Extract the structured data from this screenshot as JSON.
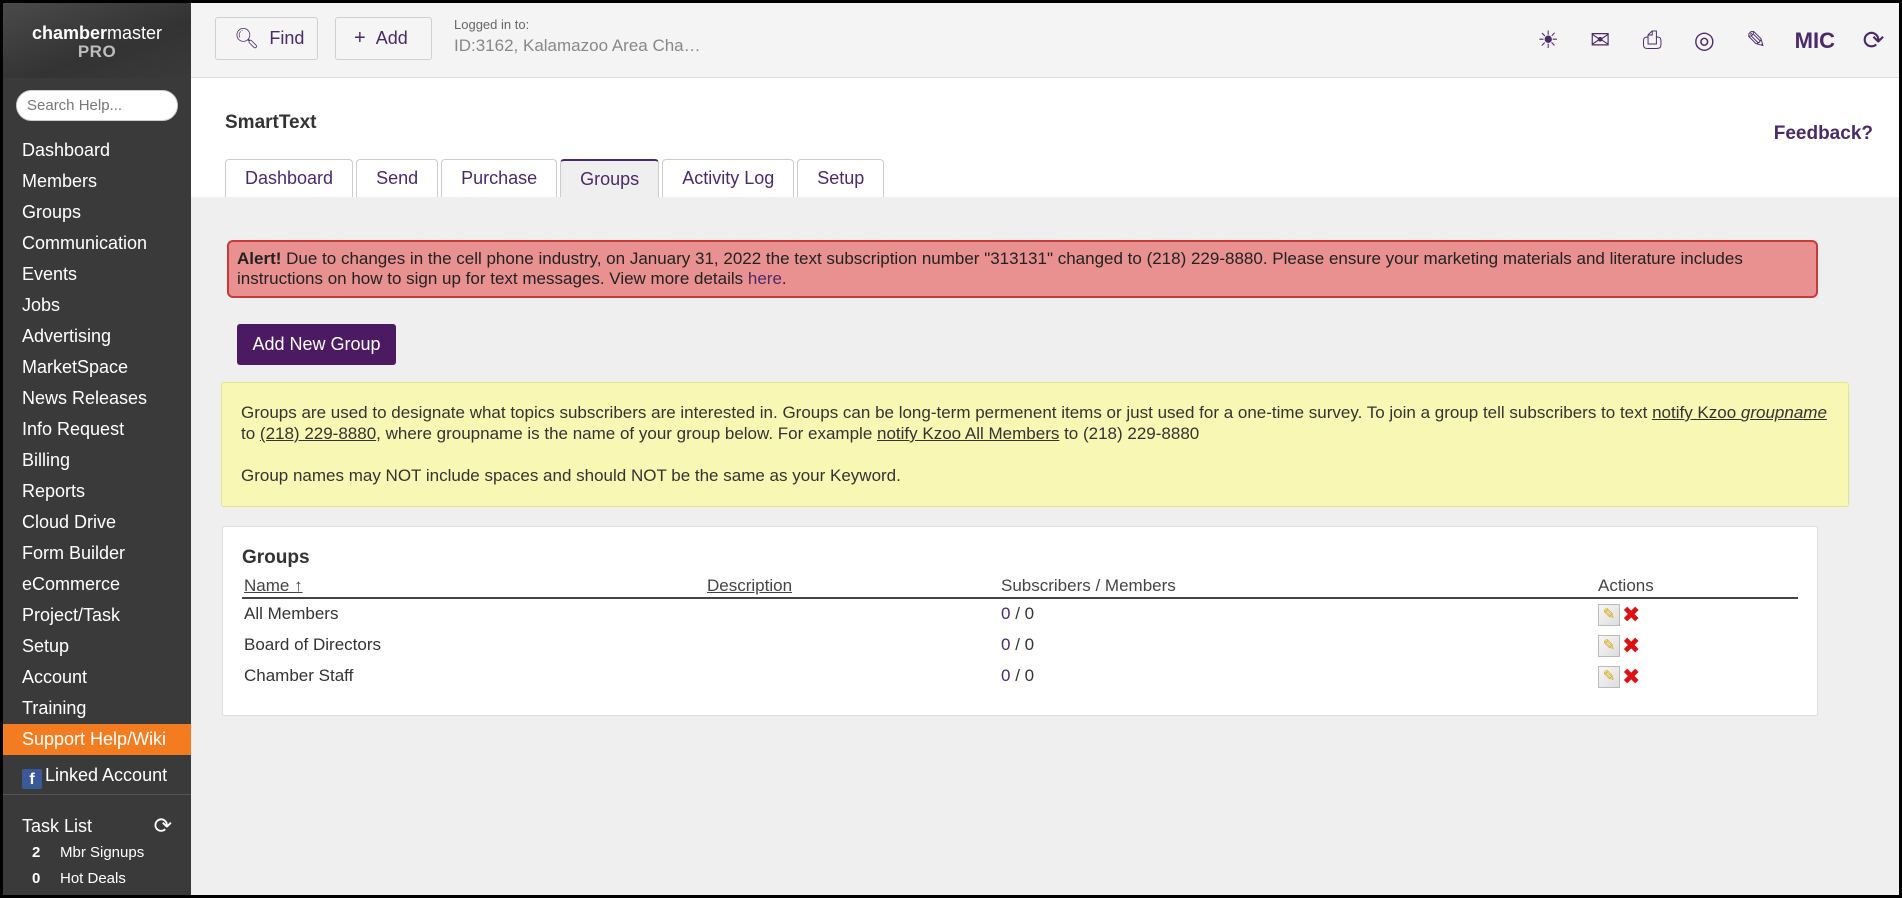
{
  "sidebar": {
    "logo_bold": "chamber",
    "logo_rest": "master",
    "logo_sub": "PRO",
    "search_placeholder": "Search Help...",
    "items": [
      "Dashboard",
      "Members",
      "Groups",
      "Communication",
      "Events",
      "Jobs",
      "Advertising",
      "MarketSpace",
      "News Releases",
      "Info Request",
      "Billing",
      "Reports",
      "Cloud Drive",
      "Form Builder",
      "eCommerce",
      "Project/Task",
      "Setup",
      "Account",
      "Training"
    ],
    "support": "Support Help/Wiki",
    "linked": "Linked Account",
    "tasklist": {
      "title": "Task List",
      "tasks": [
        {
          "count": "2",
          "label": "Mbr Signups"
        },
        {
          "count": "0",
          "label": "Hot Deals"
        }
      ]
    }
  },
  "topbar": {
    "find": "Find",
    "add": "Add",
    "login_caption": "Logged in to:",
    "login_value": "ID:3162, Kalamazoo Area Cha…",
    "user": "MIC"
  },
  "header": {
    "title": "SmartText",
    "feedback": "Feedback?",
    "tabs": [
      "Dashboard",
      "Send",
      "Purchase",
      "Groups",
      "Activity Log",
      "Setup"
    ]
  },
  "alert": {
    "bold": "Alert!",
    "text": " Due to changes in the cell phone industry, on January 31, 2022 the text subscription number \"313131\" changed to (218) 229-8880. Please ensure your marketing materials and literature includes instructions on how to sign up for text messages. View more details ",
    "link": "here",
    "end": "."
  },
  "add_group": "Add New Group",
  "info": {
    "p1a": "Groups are used to designate what topics subscribers are interested in. Groups can be long-term permenent items or just used for a one-time survey. To join a group tell subscribers to text ",
    "p1b": "notify Kzoo ",
    "p1c": "groupname",
    "p1d": " to ",
    "p1e": "(218) 229-8880",
    "p1f": ", where groupname is the name of your group below. For example ",
    "p1g": "notify Kzoo All Members",
    "p1h": " to (218) 229-8880",
    "p2": "Group names may NOT include spaces and should NOT be the same as your Keyword."
  },
  "groups": {
    "title": "Groups",
    "columns": {
      "name": "Name ↑",
      "description": "Description",
      "subs": "Subscribers / Members",
      "actions": "Actions"
    },
    "rows": [
      {
        "name": "All Members",
        "description": "",
        "subscribers": "0",
        "members": " / 0"
      },
      {
        "name": "Board of Directors",
        "description": "",
        "subscribers": "0",
        "members": " / 0"
      },
      {
        "name": "Chamber Staff",
        "description": "",
        "subscribers": "0",
        "members": " / 0"
      }
    ]
  }
}
